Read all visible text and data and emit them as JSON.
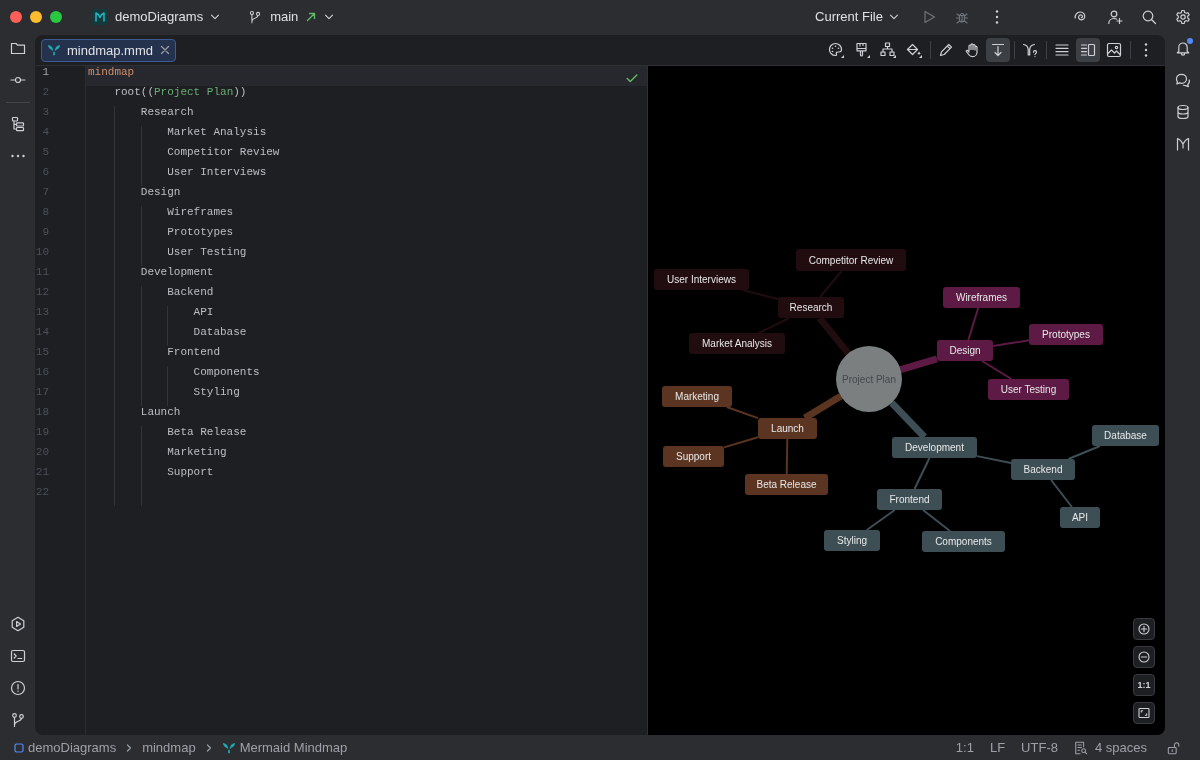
{
  "title_bar": {
    "project": "demoDiagrams",
    "branch": "main",
    "run_configuration": "Current File"
  },
  "notifications": {
    "unread": true
  },
  "editor": {
    "tabs": [
      {
        "label": "mindmap.mmd",
        "selected": true
      }
    ],
    "lines": [
      {
        "number": "1",
        "current": true,
        "tokens": [
          {
            "kind": "keyword",
            "text": "mindmap"
          }
        ]
      },
      {
        "number": "2",
        "current": false,
        "tokens": [
          {
            "kind": "plain",
            "text": "    root(("
          },
          {
            "kind": "string",
            "text": "Project Plan"
          },
          {
            "kind": "plain",
            "text": "))"
          }
        ]
      },
      {
        "number": "3",
        "current": false,
        "tokens": [
          {
            "kind": "plain",
            "text": "        Research"
          }
        ]
      },
      {
        "number": "4",
        "current": false,
        "tokens": [
          {
            "kind": "plain",
            "text": "            Market Analysis"
          }
        ]
      },
      {
        "number": "5",
        "current": false,
        "tokens": [
          {
            "kind": "plain",
            "text": "            Competitor Review"
          }
        ]
      },
      {
        "number": "6",
        "current": false,
        "tokens": [
          {
            "kind": "plain",
            "text": "            User Interviews"
          }
        ]
      },
      {
        "number": "7",
        "current": false,
        "tokens": [
          {
            "kind": "plain",
            "text": "        Design"
          }
        ]
      },
      {
        "number": "8",
        "current": false,
        "tokens": [
          {
            "kind": "plain",
            "text": "            Wireframes"
          }
        ]
      },
      {
        "number": "9",
        "current": false,
        "tokens": [
          {
            "kind": "plain",
            "text": "            Prototypes"
          }
        ]
      },
      {
        "number": "10",
        "current": false,
        "tokens": [
          {
            "kind": "plain",
            "text": "            User Testing"
          }
        ]
      },
      {
        "number": "11",
        "current": false,
        "tokens": [
          {
            "kind": "plain",
            "text": "        Development"
          }
        ]
      },
      {
        "number": "12",
        "current": false,
        "tokens": [
          {
            "kind": "plain",
            "text": "            Backend"
          }
        ]
      },
      {
        "number": "13",
        "current": false,
        "tokens": [
          {
            "kind": "plain",
            "text": "                API"
          }
        ]
      },
      {
        "number": "14",
        "current": false,
        "tokens": [
          {
            "kind": "plain",
            "text": "                Database"
          }
        ]
      },
      {
        "number": "15",
        "current": false,
        "tokens": [
          {
            "kind": "plain",
            "text": "            Frontend"
          }
        ]
      },
      {
        "number": "16",
        "current": false,
        "tokens": [
          {
            "kind": "plain",
            "text": "                Components"
          }
        ]
      },
      {
        "number": "17",
        "current": false,
        "tokens": [
          {
            "kind": "plain",
            "text": "                Styling"
          }
        ]
      },
      {
        "number": "18",
        "current": false,
        "tokens": [
          {
            "kind": "plain",
            "text": "        Launch"
          }
        ]
      },
      {
        "number": "19",
        "current": false,
        "tokens": [
          {
            "kind": "plain",
            "text": "            Beta Release"
          }
        ]
      },
      {
        "number": "20",
        "current": false,
        "tokens": [
          {
            "kind": "plain",
            "text": "            Marketing"
          }
        ]
      },
      {
        "number": "21",
        "current": false,
        "tokens": [
          {
            "kind": "plain",
            "text": "            Support"
          }
        ]
      },
      {
        "number": "22",
        "current": false
      }
    ]
  },
  "preview_toolbar": {
    "groups": [
      {
        "items": [
          {
            "kind": "theme",
            "selected": false
          },
          {
            "kind": "style",
            "selected": false
          },
          {
            "kind": "layout",
            "selected": false
          },
          {
            "kind": "fill",
            "selected": false
          }
        ]
      },
      {
        "items": [
          {
            "kind": "edit",
            "selected": false
          },
          {
            "kind": "pan",
            "selected": false
          },
          {
            "kind": "scroll-sync",
            "selected": true
          }
        ]
      },
      {
        "items": [
          {
            "kind": "help",
            "selected": false
          }
        ]
      },
      {
        "items": [
          {
            "kind": "editor-only",
            "selected": false
          },
          {
            "kind": "split",
            "selected": true
          },
          {
            "kind": "preview-only",
            "selected": false
          }
        ]
      },
      {
        "items": [
          {
            "kind": "more",
            "selected": false
          }
        ]
      }
    ]
  },
  "preview": {
    "mindmap": {
      "root": "Project Plan",
      "branches": [
        {
          "label": "Research",
          "color": "#210c10",
          "children": [
            {
              "label": "Market Analysis"
            },
            {
              "label": "Competitor Review"
            },
            {
              "label": "User Interviews"
            }
          ]
        },
        {
          "label": "Design",
          "color": "#5c1a45",
          "children": [
            {
              "label": "Wireframes"
            },
            {
              "label": "Prototypes"
            },
            {
              "label": "User Testing"
            }
          ]
        },
        {
          "label": "Development",
          "color": "#3d4e55",
          "children": [
            {
              "label": "Backend",
              "children": [
                {
                  "label": "API"
                },
                {
                  "label": "Database"
                }
              ]
            },
            {
              "label": "Frontend",
              "children": [
                {
                  "label": "Styling"
                },
                {
                  "label": "Components"
                }
              ]
            }
          ]
        },
        {
          "label": "Launch",
          "color": "#5b3521",
          "children": [
            {
              "label": "Beta Release"
            },
            {
              "label": "Marketing"
            },
            {
              "label": "Support"
            }
          ]
        }
      ]
    },
    "zoom_controls": {
      "actual_size": "1:1"
    }
  },
  "status_bar": {
    "breadcrumbs": [
      {
        "kind": "module",
        "label": "demoDiagrams"
      },
      {
        "kind": "directory",
        "label": "mindmap"
      },
      {
        "kind": "file",
        "label": "Mermaid Mindmap"
      }
    ],
    "caret": "1:1",
    "line_separator": "LF",
    "encoding": "UTF-8",
    "indent": "4 spaces"
  }
}
